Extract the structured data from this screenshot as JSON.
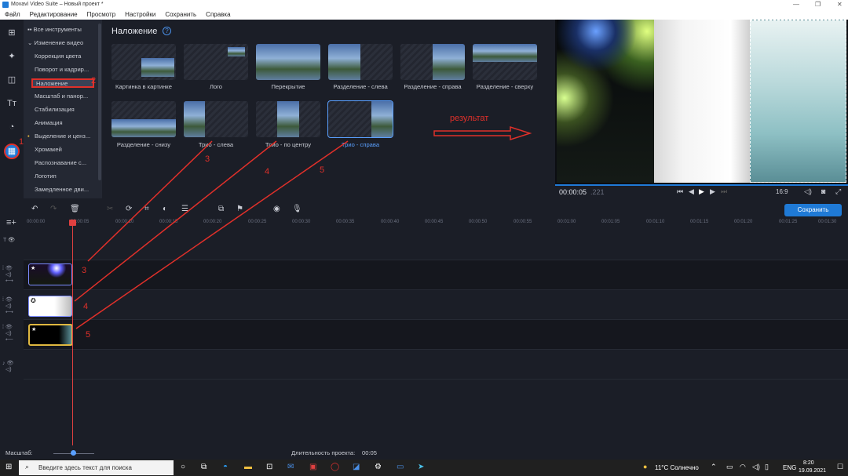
{
  "window": {
    "title": "Movavi Video Suite – Новый проект *"
  },
  "menu": [
    "Файл",
    "Редактирование",
    "Просмотр",
    "Настройки",
    "Сохранить",
    "Справка"
  ],
  "sidebar": {
    "items": [
      {
        "label": "Все инструменты"
      },
      {
        "label": "Изменение видео"
      },
      {
        "label": "Коррекция цвета"
      },
      {
        "label": "Поворот и кадрир..."
      },
      {
        "label": "Наложение"
      },
      {
        "label": "Масштаб и панор..."
      },
      {
        "label": "Стабилизация"
      },
      {
        "label": "Анимация"
      },
      {
        "label": "Выделение и ценз..."
      },
      {
        "label": "Хромакей"
      },
      {
        "label": "Распознавание с..."
      },
      {
        "label": "Логотип"
      },
      {
        "label": "Замедленное дви..."
      }
    ]
  },
  "content": {
    "title": "Наложение",
    "help": "?",
    "tiles": [
      {
        "label": "Картинка в картинке"
      },
      {
        "label": "Лого"
      },
      {
        "label": "Перекрытие"
      },
      {
        "label": "Разделение - слева"
      },
      {
        "label": "Разделение - справа"
      },
      {
        "label": "Разделение - сверху"
      },
      {
        "label": "Разделение - снизу"
      },
      {
        "label": "Трио - слева"
      },
      {
        "label": "Трио - по центру"
      },
      {
        "label": "Трио - справа"
      }
    ],
    "result_label": "результат"
  },
  "annotations": {
    "n1": "1",
    "n2": "2",
    "n3": "3",
    "n4": "4",
    "n5": "5"
  },
  "player": {
    "time": "00:00:05",
    "time_ms": ".221",
    "aspect": "16:9"
  },
  "toolbar": {
    "save_label": "Сохранить"
  },
  "ruler": [
    "00:00:00",
    "00:00:05",
    "00:00:10",
    "00:00:15",
    "00:00:20",
    "00:00:25",
    "00:00:30",
    "00:00:35",
    "00:00:40",
    "00:00:45",
    "00:00:50",
    "00:00:55",
    "00:01:00",
    "00:01:05",
    "00:01:10",
    "00:01:15",
    "00:01:20",
    "00:01:25",
    "00:01:30"
  ],
  "status": {
    "scale_label": "Масштаб:",
    "duration_label": "Длительность проекта:",
    "duration": "00:05"
  },
  "taskbar": {
    "search_placeholder": "Введите здесь текст для поиска",
    "weather": "11°C  Солнечно",
    "lang": "ENG",
    "time": "8:20",
    "date": "19.09.2021"
  },
  "colors": {
    "accent": "#1f7ad6",
    "annotation": "#e0302a",
    "playhead": "#e04040"
  }
}
